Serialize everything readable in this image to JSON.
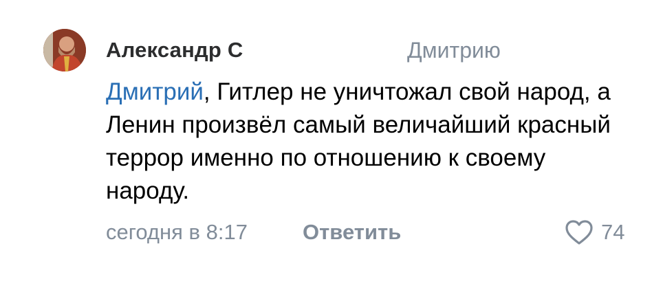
{
  "comment": {
    "author": "Александр С",
    "reply_to": "Дмитрию",
    "mention": "Дмитрий",
    "text": ", Гитлер не уничтожал свой народ, а Ленин произвёл самый величайший красный террор именно по отношению к своему народу.",
    "timestamp": "сегодня в 8:17",
    "reply_label": "Ответить",
    "like_count": "74",
    "avatar_icon": "user-avatar-photo",
    "like_icon": "heart-outline-icon",
    "colors": {
      "mention": "#2a6fb5",
      "secondary": "#818c99",
      "author": "#2c2d2e",
      "text": "#000000"
    }
  }
}
